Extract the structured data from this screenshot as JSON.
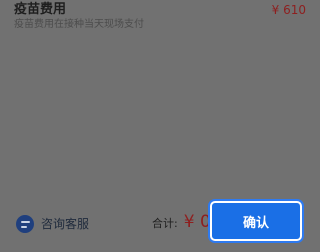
{
  "fee": {
    "title": "疫苗费用",
    "subtitle": "疫苗费用在接种当天现场支付",
    "price": "¥ 610"
  },
  "footer": {
    "consult_label": "咨询客服",
    "consult_icon": "chat-bubble-icon",
    "total_label": "合计:",
    "total_value": "¥ 0",
    "confirm_label": "确认"
  },
  "colors": {
    "overlay": "#717171",
    "price": "#8e1f1f",
    "primary": "#1a6fe6",
    "consult_icon": "#1f3f7e"
  }
}
